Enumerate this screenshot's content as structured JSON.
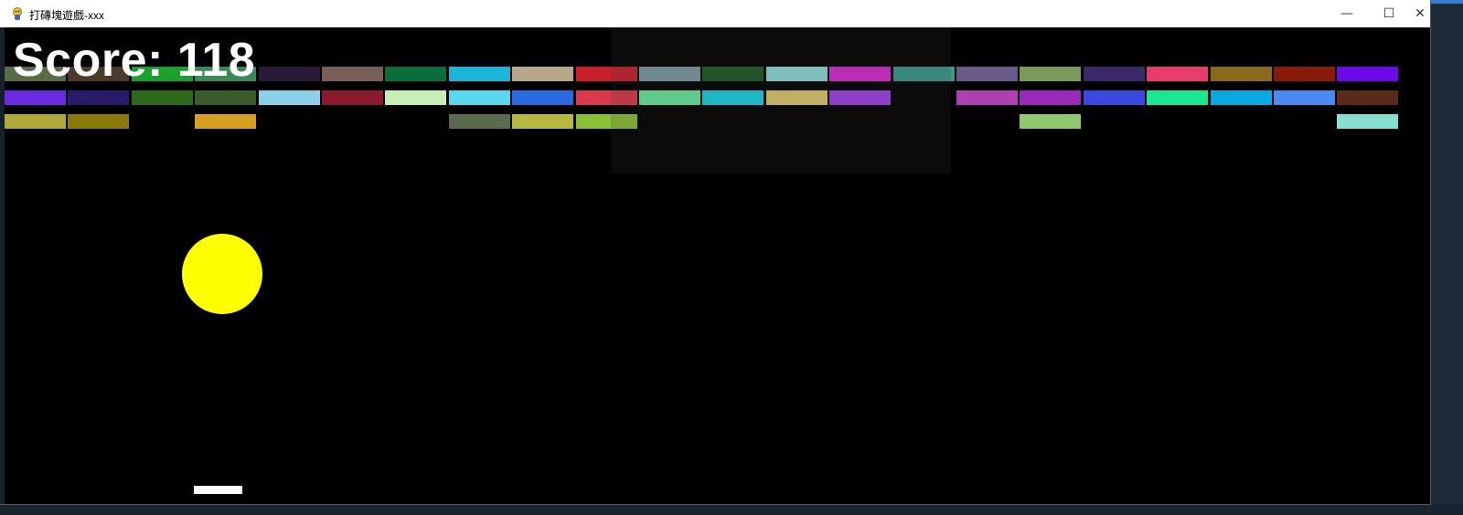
{
  "window": {
    "title": "打磚塊遊戲-xxx",
    "controls": {
      "minimize": "—",
      "maximize": "☐",
      "close": "✕"
    }
  },
  "game": {
    "score_text": "Score: 118",
    "ball_color": "#ffff00",
    "paddle_color": "#ffffff",
    "background_color": "#000000",
    "bricks": [
      {
        "row": 0,
        "col": 0,
        "color": "#5a6b4a"
      },
      {
        "row": 0,
        "col": 1,
        "color": "#4a3a2a"
      },
      {
        "row": 0,
        "col": 2,
        "color": "#1aa02c"
      },
      {
        "row": 0,
        "col": 3,
        "color": "#3c8a5a"
      },
      {
        "row": 0,
        "col": 4,
        "color": "#2a1a3a"
      },
      {
        "row": 0,
        "col": 5,
        "color": "#7a5e58"
      },
      {
        "row": 0,
        "col": 6,
        "color": "#0a6e3c"
      },
      {
        "row": 0,
        "col": 7,
        "color": "#1ab6d8"
      },
      {
        "row": 0,
        "col": 8,
        "color": "#b8a888"
      },
      {
        "row": 0,
        "col": 9,
        "color": "#c8202c"
      },
      {
        "row": 0,
        "col": 10,
        "color": "#7a9aa0"
      },
      {
        "row": 0,
        "col": 11,
        "color": "#1e5a28"
      },
      {
        "row": 0,
        "col": 12,
        "color": "#8ed8d8"
      },
      {
        "row": 0,
        "col": 13,
        "color": "#d82ad0"
      },
      {
        "row": 0,
        "col": 14,
        "color": "#3a9a8a"
      },
      {
        "row": 0,
        "col": 15,
        "color": "#6a5a8a"
      },
      {
        "row": 0,
        "col": 16,
        "color": "#7a9a5a"
      },
      {
        "row": 0,
        "col": 17,
        "color": "#3a2a6a"
      },
      {
        "row": 0,
        "col": 18,
        "color": "#e83c6a"
      },
      {
        "row": 0,
        "col": 19,
        "color": "#8a6a1a"
      },
      {
        "row": 0,
        "col": 20,
        "color": "#8a1a0a"
      },
      {
        "row": 0,
        "col": 21,
        "color": "#6a0ae8"
      },
      {
        "row": 1,
        "col": 0,
        "color": "#6a2ae0"
      },
      {
        "row": 1,
        "col": 1,
        "color": "#2a1a6a"
      },
      {
        "row": 1,
        "col": 2,
        "color": "#2a6a1a"
      },
      {
        "row": 1,
        "col": 3,
        "color": "#3a5a2a"
      },
      {
        "row": 1,
        "col": 4,
        "color": "#8ad0e8"
      },
      {
        "row": 1,
        "col": 5,
        "color": "#8a1a2a"
      },
      {
        "row": 1,
        "col": 6,
        "color": "#c8eeb8"
      },
      {
        "row": 1,
        "col": 7,
        "color": "#5ad8f0"
      },
      {
        "row": 1,
        "col": 8,
        "color": "#2a6ae0"
      },
      {
        "row": 1,
        "col": 9,
        "color": "#d83a4a"
      },
      {
        "row": 1,
        "col": 10,
        "color": "#6aeaa0"
      },
      {
        "row": 1,
        "col": 11,
        "color": "#1ad0e0"
      },
      {
        "row": 1,
        "col": 12,
        "color": "#e0c870"
      },
      {
        "row": 1,
        "col": 13,
        "color": "#a040e8"
      },
      {
        "row": 1,
        "col": 15,
        "color": "#b040b0"
      },
      {
        "row": 1,
        "col": 16,
        "color": "#9a2ab8"
      },
      {
        "row": 1,
        "col": 17,
        "color": "#3a4ae0"
      },
      {
        "row": 1,
        "col": 18,
        "color": "#1ae890"
      },
      {
        "row": 1,
        "col": 19,
        "color": "#0aa8e0"
      },
      {
        "row": 1,
        "col": 20,
        "color": "#4a8af0"
      },
      {
        "row": 1,
        "col": 21,
        "color": "#5a2a1a"
      },
      {
        "row": 2,
        "col": 0,
        "color": "#b0a838"
      },
      {
        "row": 2,
        "col": 1,
        "color": "#8a7a0a"
      },
      {
        "row": 2,
        "col": 3,
        "color": "#d8a020"
      },
      {
        "row": 2,
        "col": 7,
        "color": "#5a6a4a"
      },
      {
        "row": 2,
        "col": 8,
        "color": "#b8b840"
      },
      {
        "row": 2,
        "col": 9,
        "color": "#8ac038"
      },
      {
        "row": 2,
        "col": 16,
        "color": "#90c870"
      },
      {
        "row": 2,
        "col": 21,
        "color": "#88e0d0"
      }
    ]
  }
}
